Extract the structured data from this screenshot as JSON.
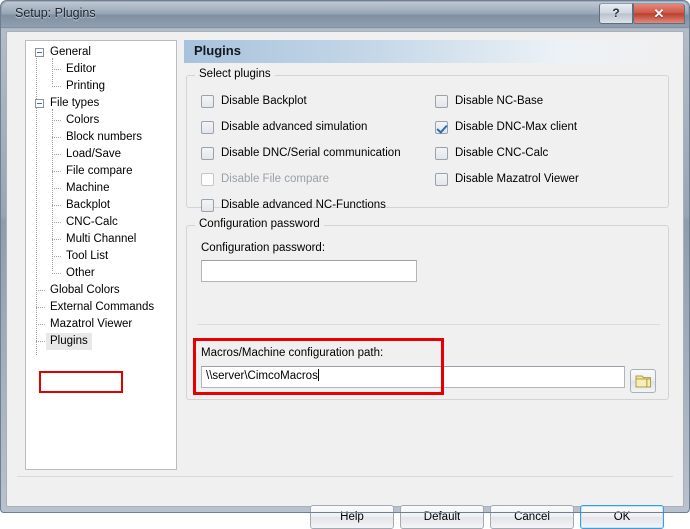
{
  "window": {
    "title": "Setup: Plugins",
    "help_button_glyph": "?",
    "close_button_glyph": "✕"
  },
  "tree": {
    "items": [
      {
        "label": "General",
        "depth": 0,
        "expandable": true,
        "selected": false
      },
      {
        "label": "Editor",
        "depth": 1,
        "expandable": false,
        "selected": false
      },
      {
        "label": "Printing",
        "depth": 1,
        "expandable": false,
        "selected": false
      },
      {
        "label": "File types",
        "depth": 0,
        "expandable": true,
        "selected": false
      },
      {
        "label": "Colors",
        "depth": 1,
        "expandable": false,
        "selected": false
      },
      {
        "label": "Block numbers",
        "depth": 1,
        "expandable": false,
        "selected": false
      },
      {
        "label": "Load/Save",
        "depth": 1,
        "expandable": false,
        "selected": false
      },
      {
        "label": "File compare",
        "depth": 1,
        "expandable": false,
        "selected": false
      },
      {
        "label": "Machine",
        "depth": 1,
        "expandable": false,
        "selected": false
      },
      {
        "label": "Backplot",
        "depth": 1,
        "expandable": false,
        "selected": false
      },
      {
        "label": "CNC-Calc",
        "depth": 1,
        "expandable": false,
        "selected": false
      },
      {
        "label": "Multi Channel",
        "depth": 1,
        "expandable": false,
        "selected": false
      },
      {
        "label": "Tool List",
        "depth": 1,
        "expandable": false,
        "selected": false
      },
      {
        "label": "Other",
        "depth": 1,
        "expandable": false,
        "selected": false
      },
      {
        "label": "Global Colors",
        "depth": 0,
        "expandable": false,
        "selected": false
      },
      {
        "label": "External Commands",
        "depth": 0,
        "expandable": false,
        "selected": false
      },
      {
        "label": "Mazatrol Viewer",
        "depth": 0,
        "expandable": false,
        "selected": false
      },
      {
        "label": "Plugins",
        "depth": 0,
        "expandable": false,
        "selected": true
      }
    ]
  },
  "page": {
    "title": "Plugins",
    "select_plugins": {
      "group_title": "Select plugins",
      "left_column": [
        {
          "label": "Disable Backplot",
          "checked": false,
          "disabled": false
        },
        {
          "label": "Disable advanced simulation",
          "checked": false,
          "disabled": false
        },
        {
          "label": "Disable DNC/Serial communication",
          "checked": false,
          "disabled": false
        },
        {
          "label": "Disable File compare",
          "checked": false,
          "disabled": true
        },
        {
          "label": "Disable advanced NC-Functions",
          "checked": false,
          "disabled": false
        }
      ],
      "right_column": [
        {
          "label": "Disable NC-Base",
          "checked": false,
          "disabled": false
        },
        {
          "label": "Disable DNC-Max client",
          "checked": true,
          "disabled": false
        },
        {
          "label": "Disable CNC-Calc",
          "checked": false,
          "disabled": false
        },
        {
          "label": "Disable Mazatrol Viewer",
          "checked": false,
          "disabled": false
        }
      ]
    },
    "configuration": {
      "group_title": "Configuration password",
      "password_label": "Configuration password:",
      "password_value": "",
      "path_label": "Macros/Machine configuration path:",
      "path_value": "\\\\server\\CimcoMacros",
      "browse_icon": "folder-icon"
    }
  },
  "footer": {
    "help_label": "Help",
    "default_label": "Default",
    "cancel_label": "Cancel",
    "ok_label": "OK"
  },
  "colors": {
    "annotation_red": "#e80000",
    "accent_blue": "#3c9ede",
    "checkmark_blue": "#2f6cb5",
    "titlebar": "#8d9dae",
    "close_button_red": "#bb3f30",
    "folder_yellow": "#e8d98a"
  }
}
